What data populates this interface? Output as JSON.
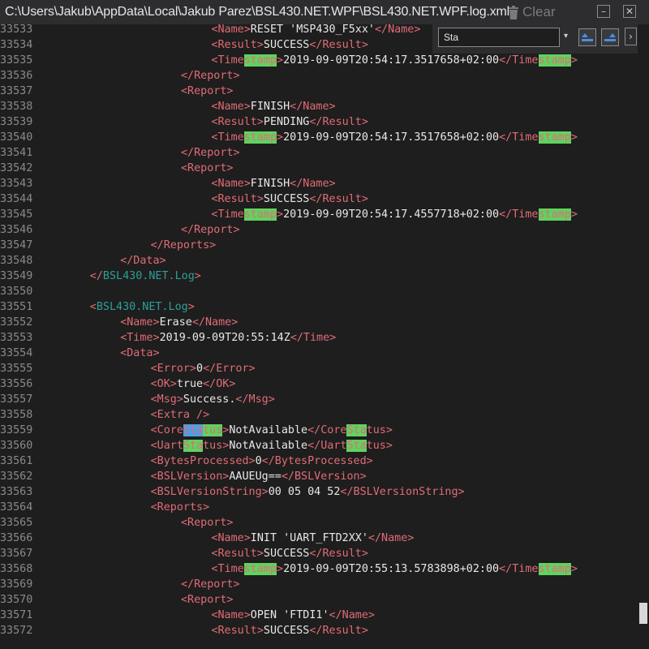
{
  "window": {
    "title": "C:\\Users\\Jakub\\AppData\\Local\\Jakub Parez\\BSL430.NET.WPF\\BSL430.NET.WPF.log.xml",
    "clear_label": "Clear"
  },
  "search": {
    "value": "Sta",
    "dropdown_glyph": "▾",
    "expand_glyph": "›",
    "prev_icon": "find-previous-icon",
    "next_icon": "find-next-icon"
  },
  "colors": {
    "tag": "#e06c75",
    "root_tag": "#2aa198",
    "text": "#e8e8e8",
    "line_number": "#8a8a8a",
    "match": "#5fd35f",
    "current_match": "#4a9fe6",
    "background": "#1e1e1e"
  },
  "lines": [
    {
      "n": "33533",
      "indent": 6,
      "parts": [
        [
          "t",
          "<Name>"
        ],
        [
          "x",
          "RESET 'MSP430_F5xx'"
        ],
        [
          "t",
          "</Name>"
        ]
      ]
    },
    {
      "n": "33534",
      "indent": 6,
      "parts": [
        [
          "t",
          "<Result>"
        ],
        [
          "x",
          "SUCCESS"
        ],
        [
          "t",
          "</Result>"
        ]
      ]
    },
    {
      "n": "33535",
      "indent": 6,
      "parts": [
        [
          "t",
          "<Time"
        ],
        [
          "h",
          "stamp"
        ],
        [
          "t",
          ">"
        ],
        [
          "x",
          "2019-09-09T20:54:17.3517658+02:00"
        ],
        [
          "t",
          "</Time"
        ],
        [
          "h",
          "stamp"
        ],
        [
          "t",
          ">"
        ]
      ]
    },
    {
      "n": "33536",
      "indent": 5,
      "parts": [
        [
          "t",
          "</Report>"
        ]
      ]
    },
    {
      "n": "33537",
      "indent": 5,
      "parts": [
        [
          "t",
          "<Report>"
        ]
      ]
    },
    {
      "n": "33538",
      "indent": 6,
      "parts": [
        [
          "t",
          "<Name>"
        ],
        [
          "x",
          "FINISH"
        ],
        [
          "t",
          "</Name>"
        ]
      ]
    },
    {
      "n": "33539",
      "indent": 6,
      "parts": [
        [
          "t",
          "<Result>"
        ],
        [
          "x",
          "PENDING"
        ],
        [
          "t",
          "</Result>"
        ]
      ]
    },
    {
      "n": "33540",
      "indent": 6,
      "parts": [
        [
          "t",
          "<Time"
        ],
        [
          "h",
          "stamp"
        ],
        [
          "t",
          ">"
        ],
        [
          "x",
          "2019-09-09T20:54:17.3517658+02:00"
        ],
        [
          "t",
          "</Time"
        ],
        [
          "h",
          "stamp"
        ],
        [
          "t",
          ">"
        ]
      ]
    },
    {
      "n": "33541",
      "indent": 5,
      "parts": [
        [
          "t",
          "</Report>"
        ]
      ]
    },
    {
      "n": "33542",
      "indent": 5,
      "parts": [
        [
          "t",
          "<Report>"
        ]
      ]
    },
    {
      "n": "33543",
      "indent": 6,
      "parts": [
        [
          "t",
          "<Name>"
        ],
        [
          "x",
          "FINISH"
        ],
        [
          "t",
          "</Name>"
        ]
      ]
    },
    {
      "n": "33544",
      "indent": 6,
      "parts": [
        [
          "t",
          "<Result>"
        ],
        [
          "x",
          "SUCCESS"
        ],
        [
          "t",
          "</Result>"
        ]
      ]
    },
    {
      "n": "33545",
      "indent": 6,
      "parts": [
        [
          "t",
          "<Time"
        ],
        [
          "h",
          "stamp"
        ],
        [
          "t",
          ">"
        ],
        [
          "x",
          "2019-09-09T20:54:17.4557718+02:00"
        ],
        [
          "t",
          "</Time"
        ],
        [
          "h",
          "stamp"
        ],
        [
          "t",
          ">"
        ]
      ]
    },
    {
      "n": "33546",
      "indent": 5,
      "parts": [
        [
          "t",
          "</Report>"
        ]
      ]
    },
    {
      "n": "33547",
      "indent": 4,
      "parts": [
        [
          "t",
          "</Reports>"
        ]
      ]
    },
    {
      "n": "33548",
      "indent": 3,
      "parts": [
        [
          "t",
          "</Data>"
        ]
      ]
    },
    {
      "n": "33549",
      "indent": 2,
      "parts": [
        [
          "t",
          "</"
        ],
        [
          "b",
          "BSL430.NET.Log"
        ],
        [
          "t",
          ">"
        ]
      ]
    },
    {
      "n": "33550",
      "indent": 0,
      "parts": []
    },
    {
      "n": "33551",
      "indent": 2,
      "parts": [
        [
          "t",
          "<"
        ],
        [
          "b",
          "BSL430.NET.Log"
        ],
        [
          "t",
          ">"
        ]
      ]
    },
    {
      "n": "33552",
      "indent": 3,
      "parts": [
        [
          "t",
          "<Name>"
        ],
        [
          "x",
          "Erase"
        ],
        [
          "t",
          "</Name>"
        ]
      ]
    },
    {
      "n": "33553",
      "indent": 3,
      "parts": [
        [
          "t",
          "<Time>"
        ],
        [
          "x",
          "2019-09-09T20:55:14Z"
        ],
        [
          "t",
          "</Time>"
        ]
      ]
    },
    {
      "n": "33554",
      "indent": 3,
      "parts": [
        [
          "t",
          "<Data>"
        ]
      ]
    },
    {
      "n": "33555",
      "indent": 4,
      "parts": [
        [
          "t",
          "<Error>"
        ],
        [
          "x",
          "0"
        ],
        [
          "t",
          "</Error>"
        ]
      ]
    },
    {
      "n": "33556",
      "indent": 4,
      "parts": [
        [
          "t",
          "<OK>"
        ],
        [
          "x",
          "true"
        ],
        [
          "t",
          "</OK>"
        ]
      ]
    },
    {
      "n": "33557",
      "indent": 4,
      "parts": [
        [
          "t",
          "<Msg>"
        ],
        [
          "x",
          "Success."
        ],
        [
          "t",
          "</Msg>"
        ]
      ]
    },
    {
      "n": "33558",
      "indent": 4,
      "parts": [
        [
          "t",
          "<Extra />"
        ]
      ]
    },
    {
      "n": "33559",
      "indent": 4,
      "parts": [
        [
          "t",
          "<Core"
        ],
        [
          "s",
          "Sta"
        ],
        [
          "h",
          "tus"
        ],
        [
          "t",
          ">"
        ],
        [
          "x",
          "NotAvailable"
        ],
        [
          "t",
          "</Core"
        ],
        [
          "h",
          "Sta"
        ],
        [
          "t",
          "tus>"
        ]
      ]
    },
    {
      "n": "33560",
      "indent": 4,
      "parts": [
        [
          "t",
          "<Uart"
        ],
        [
          "h",
          "Sta"
        ],
        [
          "t",
          "tus>"
        ],
        [
          "x",
          "NotAvailable"
        ],
        [
          "t",
          "</Uart"
        ],
        [
          "h",
          "Sta"
        ],
        [
          "t",
          "tus>"
        ]
      ]
    },
    {
      "n": "33561",
      "indent": 4,
      "parts": [
        [
          "t",
          "<BytesProcessed>"
        ],
        [
          "x",
          "0"
        ],
        [
          "t",
          "</BytesProcessed>"
        ]
      ]
    },
    {
      "n": "33562",
      "indent": 4,
      "parts": [
        [
          "t",
          "<BSLVersion>"
        ],
        [
          "x",
          "AAUEUg=="
        ],
        [
          "t",
          "</BSLVersion>"
        ]
      ]
    },
    {
      "n": "33563",
      "indent": 4,
      "parts": [
        [
          "t",
          "<BSLVersionString>"
        ],
        [
          "x",
          "00 05 04 52"
        ],
        [
          "t",
          "</BSLVersionString>"
        ]
      ]
    },
    {
      "n": "33564",
      "indent": 4,
      "parts": [
        [
          "t",
          "<Reports>"
        ]
      ]
    },
    {
      "n": "33565",
      "indent": 5,
      "parts": [
        [
          "t",
          "<Report>"
        ]
      ]
    },
    {
      "n": "33566",
      "indent": 6,
      "parts": [
        [
          "t",
          "<Name>"
        ],
        [
          "x",
          "INIT 'UART_FTD2XX'"
        ],
        [
          "t",
          "</Name>"
        ]
      ]
    },
    {
      "n": "33567",
      "indent": 6,
      "parts": [
        [
          "t",
          "<Result>"
        ],
        [
          "x",
          "SUCCESS"
        ],
        [
          "t",
          "</Result>"
        ]
      ]
    },
    {
      "n": "33568",
      "indent": 6,
      "parts": [
        [
          "t",
          "<Time"
        ],
        [
          "h",
          "stamp"
        ],
        [
          "t",
          ">"
        ],
        [
          "x",
          "2019-09-09T20:55:13.5783898+02:00"
        ],
        [
          "t",
          "</Time"
        ],
        [
          "h",
          "stamp"
        ],
        [
          "t",
          ">"
        ]
      ]
    },
    {
      "n": "33569",
      "indent": 5,
      "parts": [
        [
          "t",
          "</Report>"
        ]
      ]
    },
    {
      "n": "33570",
      "indent": 5,
      "parts": [
        [
          "t",
          "<Report>"
        ]
      ]
    },
    {
      "n": "33571",
      "indent": 6,
      "parts": [
        [
          "t",
          "<Name>"
        ],
        [
          "x",
          "OPEN 'FTDI1'"
        ],
        [
          "t",
          "</Name>"
        ]
      ]
    },
    {
      "n": "33572",
      "indent": 6,
      "parts": [
        [
          "t",
          "<Result>"
        ],
        [
          "x",
          "SUCCESS"
        ],
        [
          "t",
          "</Result>"
        ]
      ]
    }
  ]
}
